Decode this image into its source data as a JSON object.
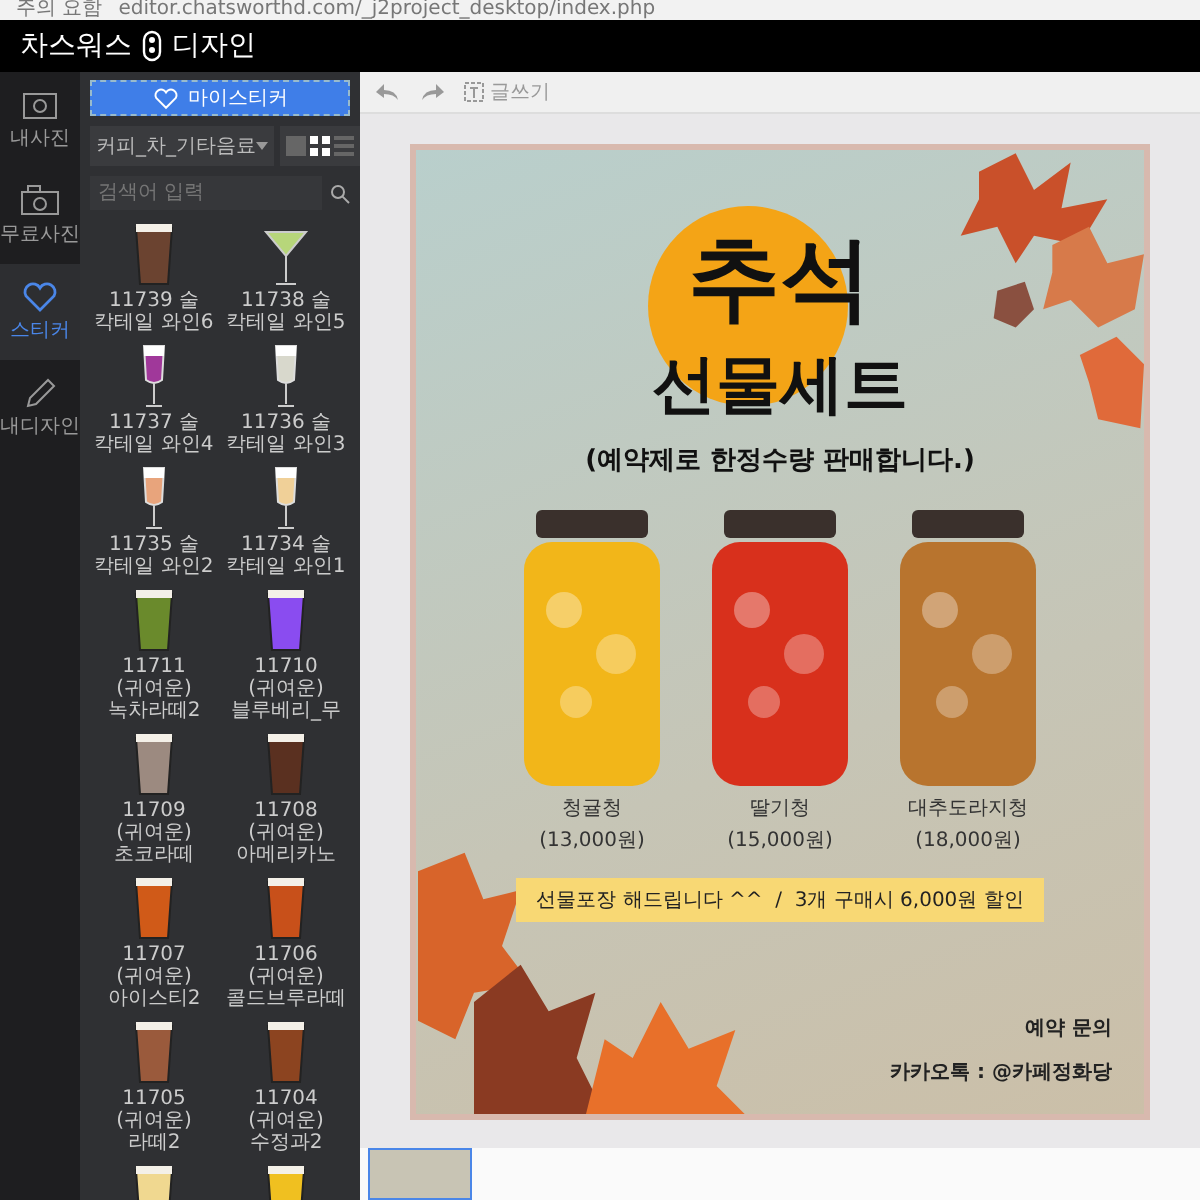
{
  "browser": {
    "security": "주의 요함",
    "url": "editor.chatsworthd.com/_j2project_desktop/index.php"
  },
  "app": {
    "brand_left": "차스워스",
    "brand_right": "디자인"
  },
  "rail": [
    {
      "label": "내사진",
      "kind": "photo",
      "selected": false
    },
    {
      "label": "무료사진",
      "kind": "free",
      "selected": false
    },
    {
      "label": "스티커",
      "kind": "heart",
      "selected": true
    },
    {
      "label": "내디자인",
      "kind": "pencil",
      "selected": false
    }
  ],
  "panel": {
    "button": "마이스티커",
    "category": "커피_차_기타음료",
    "search_placeholder": "검색어 입력",
    "view_modes": [
      {
        "kind": "large",
        "selected": false
      },
      {
        "kind": "grid",
        "selected": true
      },
      {
        "kind": "list",
        "selected": false
      }
    ],
    "stickers": [
      {
        "label": "11739 술 칵테일 와인6",
        "kind": "cup",
        "color": "#6b4330"
      },
      {
        "label": "11738 술 칵테일 와인5",
        "kind": "martini",
        "color": "#b7d67a"
      },
      {
        "label": "11737 술 칵테일 와인4",
        "kind": "flute",
        "color": "#a0389a"
      },
      {
        "label": "11736 술 칵테일 와인3",
        "kind": "flute",
        "color": "#d8d8cc"
      },
      {
        "label": "11735 술 칵테일 와인2",
        "kind": "flute",
        "color": "#e8a47c"
      },
      {
        "label": "11734 술 칵테일 와인1",
        "kind": "flute",
        "color": "#f0d098"
      },
      {
        "label": "11711 (귀여운)녹차라떼2",
        "kind": "cup",
        "color": "#6a8a2c"
      },
      {
        "label": "11710 (귀여운)블루베리_무",
        "kind": "cup",
        "color": "#8a4cf0"
      },
      {
        "label": "11709 (귀여운)초코라떼",
        "kind": "cup",
        "color": "#9c8a80"
      },
      {
        "label": "11708 (귀여운)아메리카노",
        "kind": "cup",
        "color": "#5a3020"
      },
      {
        "label": "11707 (귀여운)아이스티2",
        "kind": "cup",
        "color": "#d05a18"
      },
      {
        "label": "11706 (귀여운)콜드브루라떼",
        "kind": "cup",
        "color": "#c8501a"
      },
      {
        "label": "11705 (귀여운) 라떼2",
        "kind": "cup",
        "color": "#9a5a3c"
      },
      {
        "label": "11704 (귀여운) 수정과2",
        "kind": "cup",
        "color": "#8c4420"
      }
    ],
    "more_stickers": [
      {
        "kind": "cup",
        "color": "#f0d890"
      },
      {
        "kind": "cup",
        "color": "#f0c020"
      }
    ]
  },
  "toolbar": {
    "write": "글쓰기"
  },
  "poster": {
    "title": "추석",
    "subtitle": "선물세트",
    "note": "(예약제로 한정수량 판매합니다.)",
    "products": [
      {
        "name": "청귤청",
        "price": "(13,000원)",
        "color": "#f2b619"
      },
      {
        "name": "딸기청",
        "price": "(15,000원)",
        "color": "#d8301c"
      },
      {
        "name": "대추도라지청",
        "price": "(18,000원)",
        "color": "#b8742e"
      }
    ],
    "banner": "선물포장 해드립니다 ^^  /  3개 구매시 6,000원 할인",
    "contact_title": "예약 문의",
    "contact": "카카오톡 : @카페정화당"
  },
  "pages": [
    {
      "selected": true
    }
  ]
}
